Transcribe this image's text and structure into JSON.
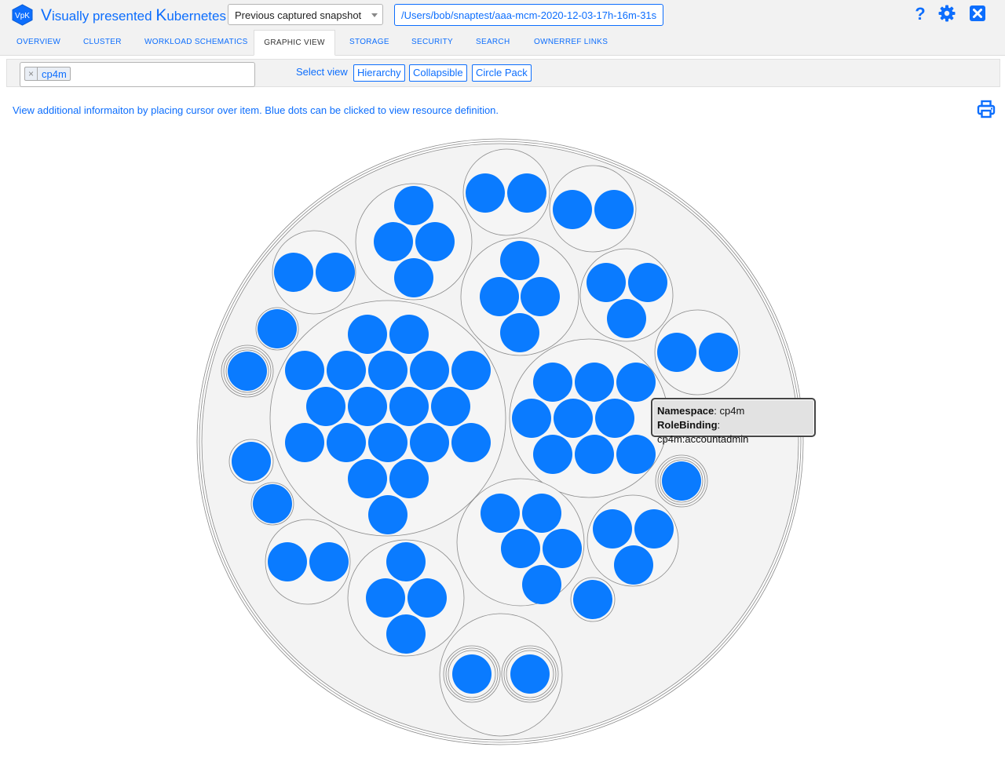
{
  "app": {
    "title_v": "V",
    "title_rest1": "isually presented ",
    "title_k": "K",
    "title_rest2": "ubernetes",
    "logo_text": "VpK"
  },
  "header": {
    "snapshot_select": "Previous captured snapshot",
    "snapshot_path": "/Users/bob/snaptest/aaa-mcm-2020-12-03-17h-16m-31s",
    "icons": [
      "help-icon",
      "settings-gear-icon",
      "close-icon"
    ]
  },
  "tabs": [
    {
      "label": "OVERVIEW"
    },
    {
      "label": "CLUSTER"
    },
    {
      "label": "WORKLOAD SCHEMATICS"
    },
    {
      "label": "GRAPHIC VIEW"
    },
    {
      "label": "STORAGE"
    },
    {
      "label": "SECURITY"
    },
    {
      "label": "SEARCH"
    },
    {
      "label": "OWNERREF LINKS"
    }
  ],
  "filter": {
    "chip_remove": "×",
    "chip_label": "cp4m",
    "select_view_label": "Select view",
    "views": [
      "Hierarchy",
      "Collapsible",
      "Circle Pack"
    ]
  },
  "info_text": "View additional informaiton by placing cursor over item. Blue dots can be clicked to view resource definition.",
  "tooltip": {
    "line1_key": "Namespace",
    "line1_val": ": cp4m",
    "line2_key": "RoleBinding",
    "line2_val": ": cp4m:accountadmin"
  },
  "colors": {
    "accent": "#0d6efd",
    "dot": "#0a7bff",
    "pack_fill": "#f3f3f3",
    "pack_stroke": "#8a8a8a"
  }
}
